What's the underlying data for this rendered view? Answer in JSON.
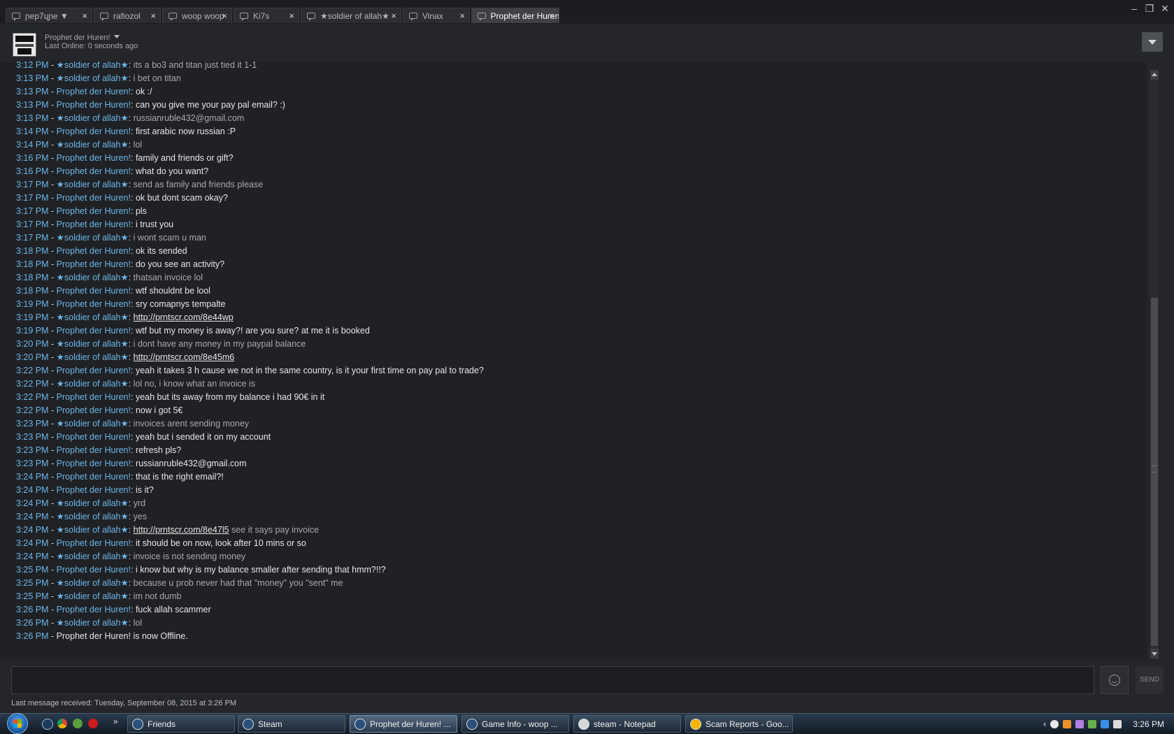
{
  "tabs": [
    {
      "label": "ɲep7ɥɲe ▼"
    },
    {
      "label": "rafiozol"
    },
    {
      "label": "woop woop"
    },
    {
      "label": "Ki7s"
    },
    {
      "label": "★soldier of allah★"
    },
    {
      "label": "Vinax"
    },
    {
      "label": "Prophet der Huren!"
    }
  ],
  "window_controls": {
    "minimize": "–",
    "maximize": "❐",
    "close": "✕"
  },
  "header": {
    "name": "Prophet der Huren!",
    "status": "Last Online: 0 seconds ago",
    "avatar_icon": "user-avatar"
  },
  "speakers": {
    "prophet": "Prophet der Huren!",
    "soldier": "soldier of allah"
  },
  "messages": [
    {
      "time": "3:12 PM",
      "who": "soldier",
      "text": "its a bo3 and titan just tied it 1-1"
    },
    {
      "time": "3:13 PM",
      "who": "soldier",
      "text": "i bet on titan"
    },
    {
      "time": "3:13 PM",
      "who": "prophet",
      "text": "ok :/"
    },
    {
      "time": "3:13 PM",
      "who": "prophet",
      "text": "can you give me your pay pal email? :)"
    },
    {
      "time": "3:13 PM",
      "who": "soldier",
      "text": "russianruble432@gmail.com"
    },
    {
      "time": "3:14 PM",
      "who": "prophet",
      "text": "first arabic now russian :P"
    },
    {
      "time": "3:14 PM",
      "who": "soldier",
      "text": "lol"
    },
    {
      "time": "3:16 PM",
      "who": "prophet",
      "text": "family and friends or gift?"
    },
    {
      "time": "3:16 PM",
      "who": "prophet",
      "text": "what do you want?"
    },
    {
      "time": "3:17 PM",
      "who": "soldier",
      "text": "send as family and friends please"
    },
    {
      "time": "3:17 PM",
      "who": "prophet",
      "text": "ok but dont scam okay?"
    },
    {
      "time": "3:17 PM",
      "who": "prophet",
      "text": "pls"
    },
    {
      "time": "3:17 PM",
      "who": "prophet",
      "text": "i trust you"
    },
    {
      "time": "3:17 PM",
      "who": "soldier",
      "text": "i wont scam u man"
    },
    {
      "time": "3:18 PM",
      "who": "prophet",
      "text": "ok its sended"
    },
    {
      "time": "3:18 PM",
      "who": "prophet",
      "text": "do you see an activity?"
    },
    {
      "time": "3:18 PM",
      "who": "soldier",
      "text": "thatsan invoice lol"
    },
    {
      "time": "3:18 PM",
      "who": "prophet",
      "text": "wtf shouldnt be lool"
    },
    {
      "time": "3:19 PM",
      "who": "prophet",
      "text": "sry comapnys tempalte"
    },
    {
      "time": "3:19 PM",
      "who": "soldier",
      "link": "http://prntscr.com/8e44wp",
      "text": ""
    },
    {
      "time": "3:19 PM",
      "who": "prophet",
      "text": "wtf but my money is away?! are you sure? at me it is booked"
    },
    {
      "time": "3:20 PM",
      "who": "soldier",
      "text": "i dont have any money in my paypal balance"
    },
    {
      "time": "3:20 PM",
      "who": "soldier",
      "link": "http://prntscr.com/8e45m6",
      "text": ""
    },
    {
      "time": "3:22 PM",
      "who": "prophet",
      "text": "yeah it takes 3 h cause we not in the same country, is it your first time on pay pal to trade?"
    },
    {
      "time": "3:22 PM",
      "who": "soldier",
      "text": "lol no, i know what an invoice is"
    },
    {
      "time": "3:22 PM",
      "who": "prophet",
      "text": "yeah but its away from my balance i had 90€ in it"
    },
    {
      "time": "3:22 PM",
      "who": "prophet",
      "text": "now i got 5€"
    },
    {
      "time": "3:23 PM",
      "who": "soldier",
      "text": "invoices arent sending money"
    },
    {
      "time": "3:23 PM",
      "who": "prophet",
      "text": "yeah but i sended it on my account"
    },
    {
      "time": "3:23 PM",
      "who": "prophet",
      "text": "refresh pls?"
    },
    {
      "time": "3:23 PM",
      "who": "prophet",
      "text": "russianruble432@gmail.com"
    },
    {
      "time": "3:24 PM",
      "who": "prophet",
      "text": "that is the right email?!"
    },
    {
      "time": "3:24 PM",
      "who": "prophet",
      "text": "is it?"
    },
    {
      "time": "3:24 PM",
      "who": "soldier",
      "text": "yrd"
    },
    {
      "time": "3:24 PM",
      "who": "soldier",
      "text": "yes"
    },
    {
      "time": "3:24 PM",
      "who": "soldier",
      "link": "http://prntscr.com/8e47l5",
      "text": " see it says pay invoice"
    },
    {
      "time": "3:24 PM",
      "who": "prophet",
      "text": "it should be on now, look after 10 mins or so"
    },
    {
      "time": "3:24 PM",
      "who": "soldier",
      "text": "invoice is not sending money"
    },
    {
      "time": "3:25 PM",
      "who": "prophet",
      "text": "i know but why is my balance smaller after sending that hmm?!!?"
    },
    {
      "time": "3:25 PM",
      "who": "soldier",
      "text": "because u prob never had that \"money\" you \"sent\" me"
    },
    {
      "time": "3:25 PM",
      "who": "soldier",
      "text": "im not dumb"
    },
    {
      "time": "3:26 PM",
      "who": "prophet",
      "text": "fuck allah scammer"
    },
    {
      "time": "3:26 PM",
      "who": "soldier",
      "text": "lol"
    }
  ],
  "offline_notice": {
    "time": "3:26 PM",
    "text": "Prophet der Huren! is now Offline."
  },
  "composer": {
    "send_label": "SEND",
    "emoji_icon": "emoticon-icon"
  },
  "last_message": "Last message received: Tuesday, September 08, 2015 at 3:26 PM",
  "taskbar": {
    "buttons": [
      {
        "label": "Friends",
        "active": false
      },
      {
        "label": "Steam",
        "active": false
      },
      {
        "label": "Prophet der Huren! ...",
        "active": true
      },
      {
        "label": "Game Info - woop ...",
        "active": false
      },
      {
        "label": "steam - Notepad",
        "active": false
      },
      {
        "label": "Scam Reports - Goo...",
        "active": false
      }
    ],
    "overflow_arrow": "»",
    "tray_arrow": "‹",
    "clock": "3:26 PM"
  },
  "colors": {
    "timestamp": "#6cb6e8",
    "message": "#e6e6e6",
    "background": "#202124"
  }
}
